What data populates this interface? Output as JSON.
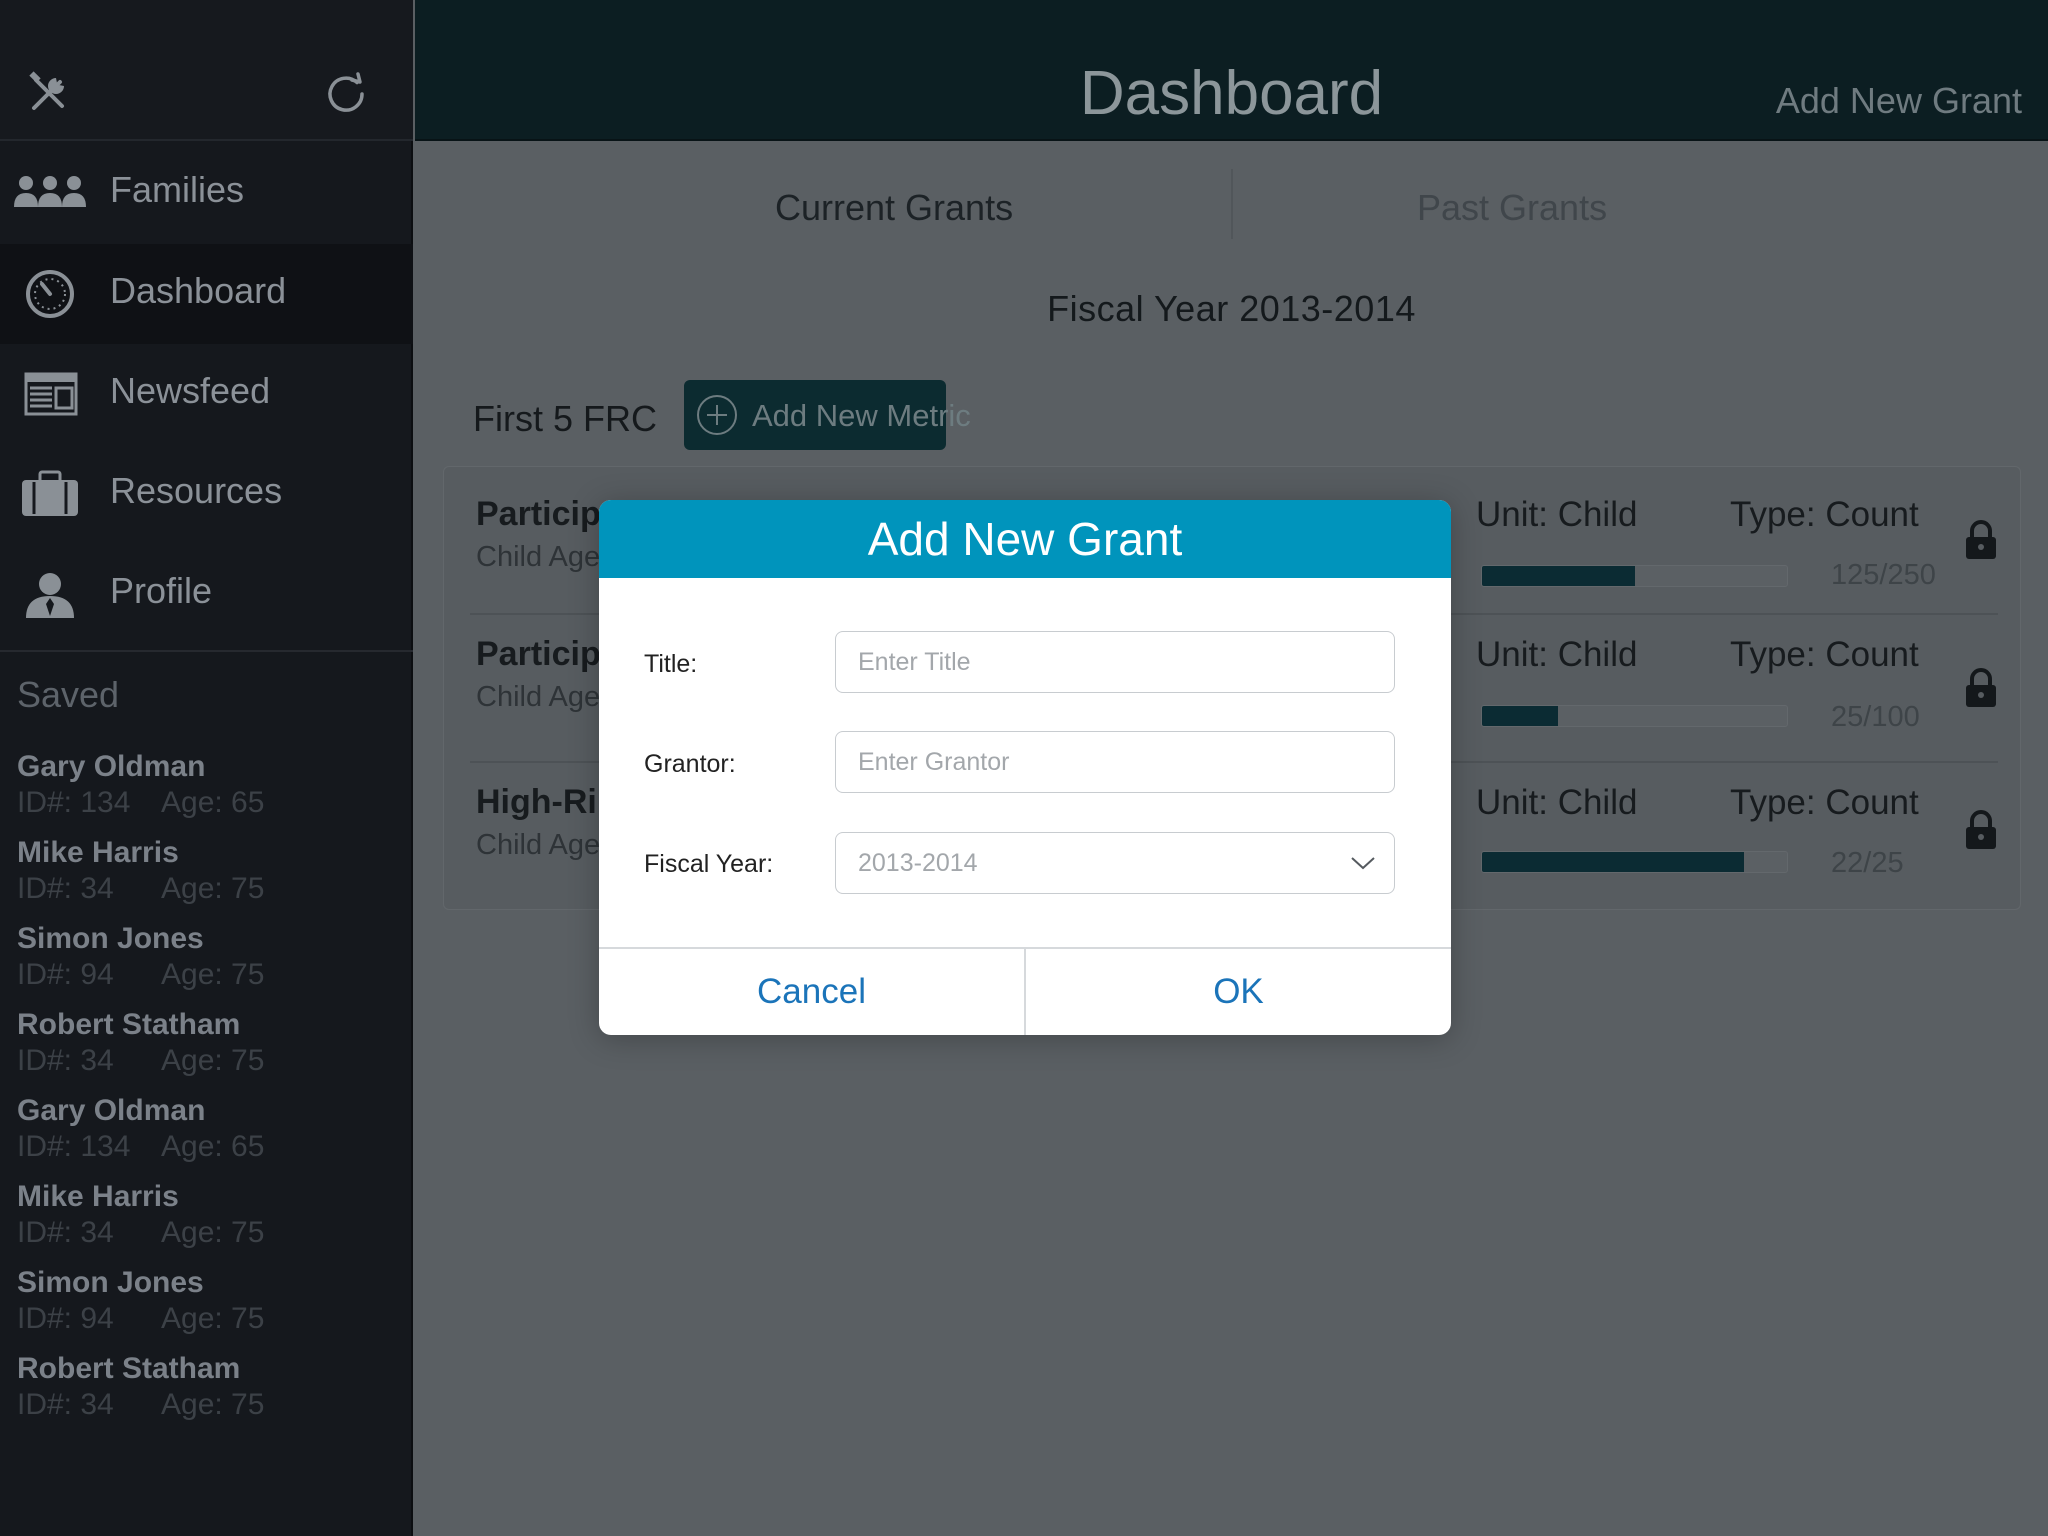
{
  "header": {
    "title": "Dashboard",
    "add_button": "Add New Grant"
  },
  "sidebar": {
    "nav": [
      {
        "label": "Families",
        "icon": "families-icon"
      },
      {
        "label": "Dashboard",
        "icon": "dashboard-gauge-icon"
      },
      {
        "label": "Newsfeed",
        "icon": "newsfeed-icon"
      },
      {
        "label": "Resources",
        "icon": "briefcase-icon"
      },
      {
        "label": "Profile",
        "icon": "profile-icon"
      }
    ],
    "active": "Dashboard",
    "saved_title": "Saved",
    "saved": [
      {
        "name": "Gary Oldman",
        "id": "ID#: 134",
        "age": "Age: 65"
      },
      {
        "name": "Mike Harris",
        "id": "ID#: 34",
        "age": "Age: 75"
      },
      {
        "name": "Simon Jones",
        "id": "ID#: 94",
        "age": "Age: 75"
      },
      {
        "name": "Robert Statham",
        "id": "ID#: 34",
        "age": "Age: 75"
      },
      {
        "name": "Gary Oldman",
        "id": "ID#: 134",
        "age": "Age: 65"
      },
      {
        "name": "Mike Harris",
        "id": "ID#: 34",
        "age": "Age: 75"
      },
      {
        "name": "Simon Jones",
        "id": "ID#: 94",
        "age": "Age: 75"
      },
      {
        "name": "Robert Statham",
        "id": "ID#: 34",
        "age": "Age: 75"
      }
    ]
  },
  "tabs": {
    "current": "Current Grants",
    "past": "Past Grants"
  },
  "fiscal_year": "Fiscal Year 2013-2014",
  "grant": {
    "name": "First 5 FRC",
    "add_metric": "Add New Metric"
  },
  "metrics": [
    {
      "title": "Particip",
      "subtitle": "Child Age",
      "unit": "Unit: Child",
      "type": "Type: Count",
      "count": "125/250",
      "progress": 0.5
    },
    {
      "title": "Particip",
      "subtitle": "Child Age",
      "unit": "Unit: Child",
      "type": "Type: Count",
      "count": "25/100",
      "progress": 0.25
    },
    {
      "title": "High-Ri",
      "subtitle": "Child Age",
      "unit": "Unit: Child",
      "type": "Type: Count",
      "count": "22/25",
      "progress": 0.86
    }
  ],
  "dialog": {
    "title": "Add New Grant",
    "title_label": "Title:",
    "title_placeholder": "Enter Title",
    "grantor_label": "Grantor:",
    "grantor_placeholder": "Enter Grantor",
    "fiscal_label": "Fiscal Year:",
    "fiscal_value": "2013-2014",
    "cancel": "Cancel",
    "ok": "OK"
  },
  "colors": {
    "dialog_header": "#0094bc",
    "button_text": "#1b74b9",
    "header_bg": "#0c1e22",
    "sidebar_bg": "#15181d"
  }
}
